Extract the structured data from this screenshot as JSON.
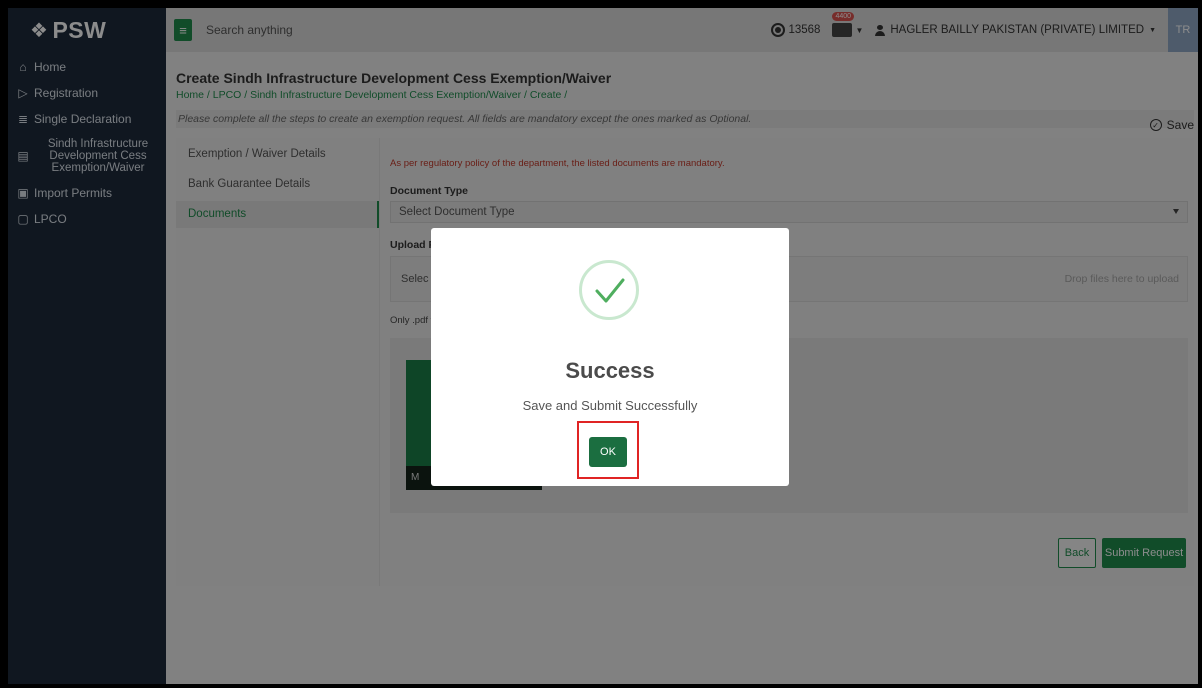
{
  "app": {
    "logo": "PSW"
  },
  "sidebar": {
    "items": [
      {
        "label": "Home"
      },
      {
        "label": "Registration"
      },
      {
        "label": "Single Declaration"
      },
      {
        "label": "Sindh Infrastructure Development Cess Exemption/Waiver"
      },
      {
        "label": "Import Permits"
      },
      {
        "label": "LPCO"
      }
    ]
  },
  "topbar": {
    "search_placeholder": "Search anything",
    "credits": "13568",
    "mail_badge": "4400",
    "company": "HAGLER BAILLY PAKISTAN (PRIVATE) LIMITED",
    "avatar": "TR"
  },
  "page": {
    "title": "Create Sindh Infrastructure Development Cess Exemption/Waiver",
    "breadcrumb": "Home / LPCO / Sindh Infrastructure Development Cess Exemption/Waiver / Create /",
    "instruction": "Please complete all the steps to create an exemption request. All fields are mandatory except the ones marked as Optional.",
    "save_label": "Save"
  },
  "steps": [
    {
      "label": "Exemption / Waiver Details"
    },
    {
      "label": "Bank Guarantee Details"
    },
    {
      "label": "Documents"
    }
  ],
  "documents": {
    "note": "As per regulatory policy of the department, the listed documents are mandatory.",
    "doc_type_label": "Document Type",
    "doc_type_placeholder": "Select Document Type",
    "upload_label": "Upload Fi",
    "select_text": "Selec",
    "drop_text": "Drop files here to upload",
    "only_text": "Only .pdf f",
    "thumb_label": "M"
  },
  "actions": {
    "back": "Back",
    "submit": "Submit Request"
  },
  "modal": {
    "title": "Success",
    "message": "Save and Submit Successfully",
    "ok": "OK"
  },
  "colors": {
    "accent": "#1f8a4c",
    "sidebar": "#1e2a3b",
    "highlight": "#e02424"
  }
}
